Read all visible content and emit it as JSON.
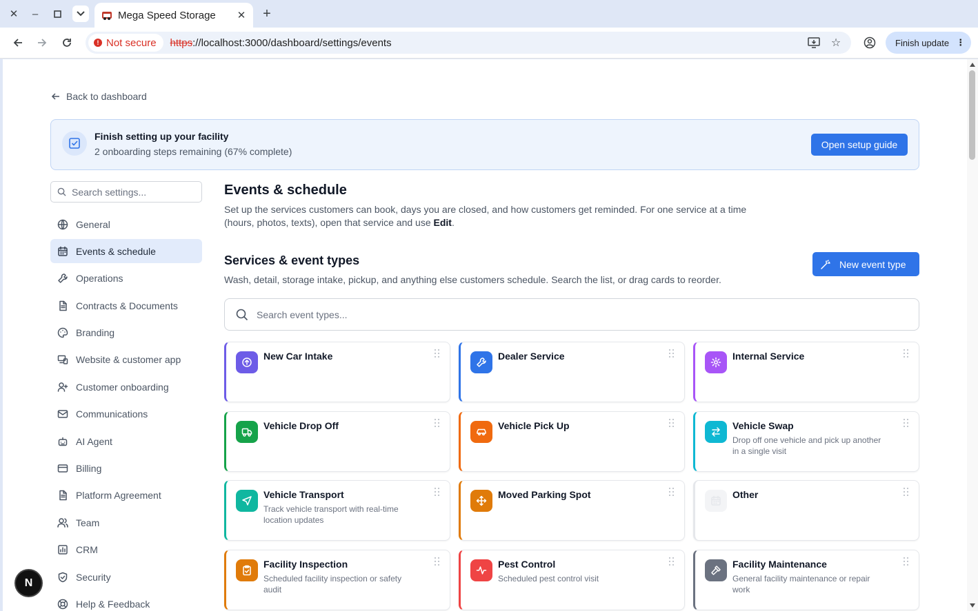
{
  "browser": {
    "tab_title": "Mega Speed Storage",
    "security_label": "Not secure",
    "url_scheme": "https",
    "url_rest": "://localhost:3000/dashboard/settings/events",
    "update_button": "Finish update"
  },
  "page": {
    "back_link": "Back to dashboard",
    "setup": {
      "title": "Finish setting up your facility",
      "subtitle": "2 onboarding steps remaining (67% complete)",
      "button": "Open setup guide"
    },
    "sidebar": {
      "search_placeholder": "Search settings...",
      "items": [
        {
          "label": "General",
          "icon": "globe-icon"
        },
        {
          "label": "Events & schedule",
          "icon": "calendar-icon",
          "active": true
        },
        {
          "label": "Operations",
          "icon": "wrench-icon"
        },
        {
          "label": "Contracts & Documents",
          "icon": "document-icon"
        },
        {
          "label": "Branding",
          "icon": "palette-icon"
        },
        {
          "label": "Website & customer app",
          "icon": "devices-icon"
        },
        {
          "label": "Customer onboarding",
          "icon": "user-plus-icon"
        },
        {
          "label": "Communications",
          "icon": "mail-icon"
        },
        {
          "label": "AI Agent",
          "icon": "bot-icon"
        },
        {
          "label": "Billing",
          "icon": "credit-card-icon"
        },
        {
          "label": "Platform Agreement",
          "icon": "document-icon"
        },
        {
          "label": "Team",
          "icon": "users-icon"
        },
        {
          "label": "CRM",
          "icon": "crm-icon"
        },
        {
          "label": "Security",
          "icon": "shield-icon"
        },
        {
          "label": "Help & Feedback",
          "icon": "help-icon"
        }
      ]
    },
    "main": {
      "title": "Events & schedule",
      "desc_prefix": "Set up the services customers can book, days you are closed, and how customers get reminded. For one service at a time (hours, photos, texts), open that service and use ",
      "desc_bold": "Edit",
      "desc_suffix": ".",
      "section_title": "Services & event types",
      "section_desc": "Wash, detail, storage intake, pickup, and anything else customers schedule. Search the list, or drag cards to reorder.",
      "new_button": "New event type",
      "search_placeholder": "Search event types..."
    },
    "event_types": [
      {
        "title": "New Car Intake",
        "desc": "",
        "color": "#6d5ce7",
        "icon": "arrow-up-circle-icon"
      },
      {
        "title": "Dealer Service",
        "desc": "",
        "color": "#2f74e8",
        "icon": "wrench-icon"
      },
      {
        "title": "Internal Service",
        "desc": "",
        "color": "#a855f7",
        "icon": "gear-icon"
      },
      {
        "title": "Vehicle Drop Off",
        "desc": "",
        "color": "#16a34a",
        "icon": "truck-icon"
      },
      {
        "title": "Vehicle Pick Up",
        "desc": "",
        "color": "#f06a0f",
        "icon": "car-icon"
      },
      {
        "title": "Vehicle Swap",
        "desc": "Drop off one vehicle and pick up another in a single visit",
        "color": "#0fb8d3",
        "icon": "swap-icon"
      },
      {
        "title": "Vehicle Transport",
        "desc": "Track vehicle transport with real-time location updates",
        "color": "#10b7a0",
        "icon": "navigation-icon"
      },
      {
        "title": "Moved Parking Spot",
        "desc": "",
        "color": "#e07b0a",
        "icon": "move-icon"
      },
      {
        "title": "Other",
        "desc": "",
        "color": "#e5e7eb",
        "icon": "calendar-icon"
      },
      {
        "title": "Facility Inspection",
        "desc": "Scheduled facility inspection or safety audit",
        "color": "#e07b0a",
        "icon": "clipboard-check-icon"
      },
      {
        "title": "Pest Control",
        "desc": "Scheduled pest control visit",
        "color": "#ef4444",
        "icon": "activity-icon"
      },
      {
        "title": "Facility Maintenance",
        "desc": "General facility maintenance or repair work",
        "color": "#6b7280",
        "icon": "hammer-icon"
      }
    ],
    "badge": "N"
  }
}
